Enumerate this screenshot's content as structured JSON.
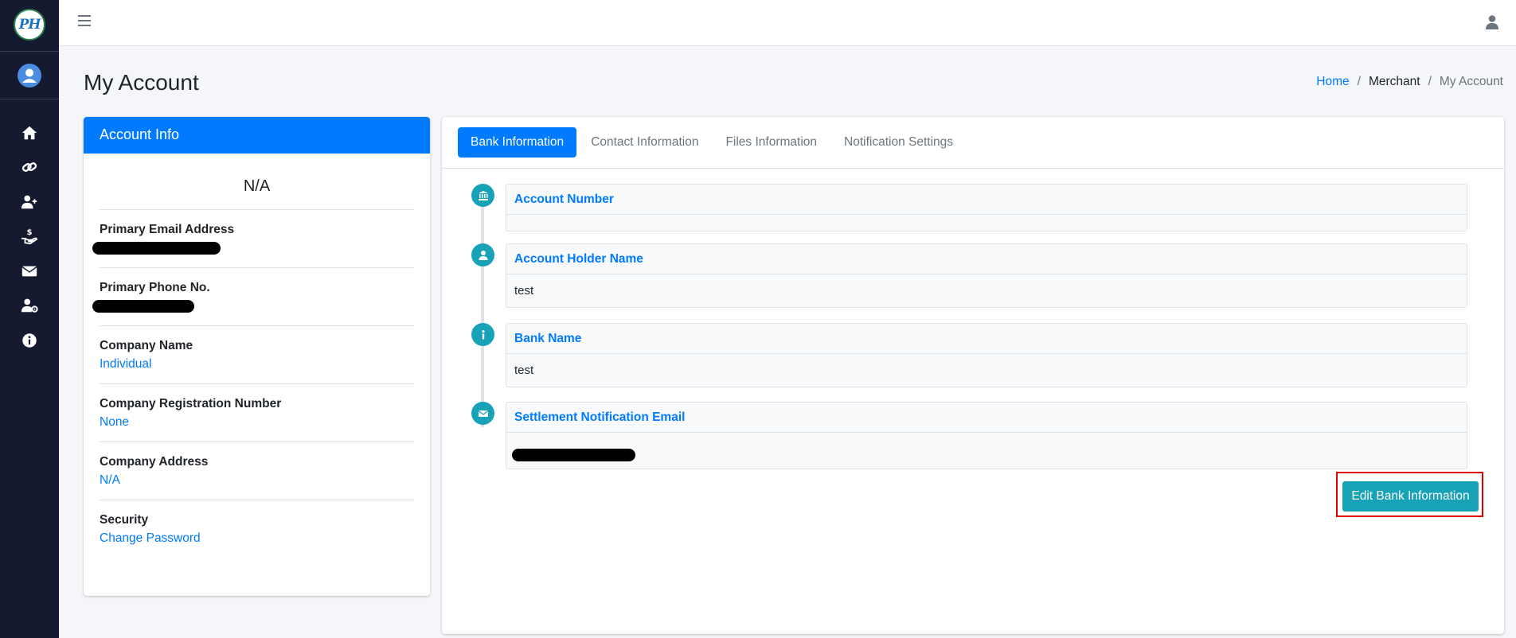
{
  "logo": {
    "text": "PH"
  },
  "sidebar": {
    "items": [
      {
        "name": "home-icon"
      },
      {
        "name": "link-icon"
      },
      {
        "name": "user-plus-icon"
      },
      {
        "name": "hand-dollar-icon"
      },
      {
        "name": "envelope-icon"
      },
      {
        "name": "user-gear-icon"
      },
      {
        "name": "info-icon"
      }
    ]
  },
  "header": {
    "title": "My Account",
    "breadcrumb": {
      "home": "Home",
      "merchant": "Merchant",
      "current": "My Account",
      "separator": "/"
    }
  },
  "account_info": {
    "header": "Account Info",
    "name": "N/A",
    "items": [
      {
        "label": "Primary Email Address",
        "value": ""
      },
      {
        "label": "Primary Phone No.",
        "value": ""
      },
      {
        "label": "Company Name",
        "value": "Individual"
      },
      {
        "label": "Company Registration Number",
        "value": "None"
      },
      {
        "label": "Company Address",
        "value": "N/A"
      },
      {
        "label": "Security",
        "value": "Change Password"
      }
    ]
  },
  "tabs": [
    {
      "label": "Bank Information",
      "active": true
    },
    {
      "label": "Contact Information",
      "active": false
    },
    {
      "label": "Files Information",
      "active": false
    },
    {
      "label": "Notification Settings",
      "active": false
    }
  ],
  "bank_info": {
    "entries": [
      {
        "icon": "bank-icon",
        "label": "Account Number",
        "value": ""
      },
      {
        "icon": "user-icon",
        "label": "Account Holder Name",
        "value": "test"
      },
      {
        "icon": "info-icon",
        "label": "Bank Name",
        "value": "test"
      },
      {
        "icon": "envelope-icon",
        "label": "Settlement Notification Email",
        "value": ""
      }
    ],
    "edit_button": "Edit Bank Information"
  },
  "colors": {
    "sidebar": "#151a30",
    "primary": "#007bff",
    "info": "#17a2b8",
    "highlight": "#e00000"
  }
}
